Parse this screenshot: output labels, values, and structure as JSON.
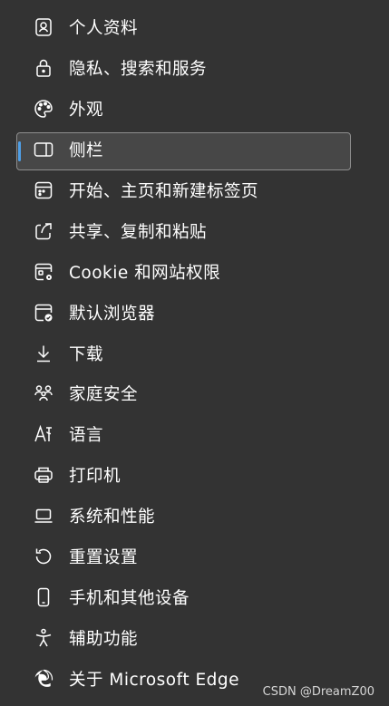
{
  "menu": {
    "items": [
      {
        "label": "个人资料",
        "icon": "profile-icon"
      },
      {
        "label": "隐私、搜索和服务",
        "icon": "lock-icon"
      },
      {
        "label": "外观",
        "icon": "palette-icon"
      },
      {
        "label": "侧栏",
        "icon": "sidebar-icon",
        "selected": true
      },
      {
        "label": "开始、主页和新建标签页",
        "icon": "start-page-icon"
      },
      {
        "label": "共享、复制和粘贴",
        "icon": "share-icon"
      },
      {
        "label": "Cookie 和网站权限",
        "icon": "cookie-site-permissions-icon"
      },
      {
        "label": "默认浏览器",
        "icon": "default-browser-icon"
      },
      {
        "label": "下载",
        "icon": "download-icon"
      },
      {
        "label": "家庭安全",
        "icon": "family-icon"
      },
      {
        "label": "语言",
        "icon": "language-icon"
      },
      {
        "label": "打印机",
        "icon": "printer-icon"
      },
      {
        "label": "系统和性能",
        "icon": "laptop-icon"
      },
      {
        "label": "重置设置",
        "icon": "reset-icon"
      },
      {
        "label": "手机和其他设备",
        "icon": "phone-icon"
      },
      {
        "label": "辅助功能",
        "icon": "accessibility-icon"
      },
      {
        "label": "关于 Microsoft Edge",
        "icon": "edge-logo-icon"
      }
    ]
  },
  "watermark": "CSDN @DreamZ00",
  "colors": {
    "background": "#333333",
    "selected_background": "#474747",
    "accent": "#4f9fe6",
    "text": "#ffffff"
  }
}
